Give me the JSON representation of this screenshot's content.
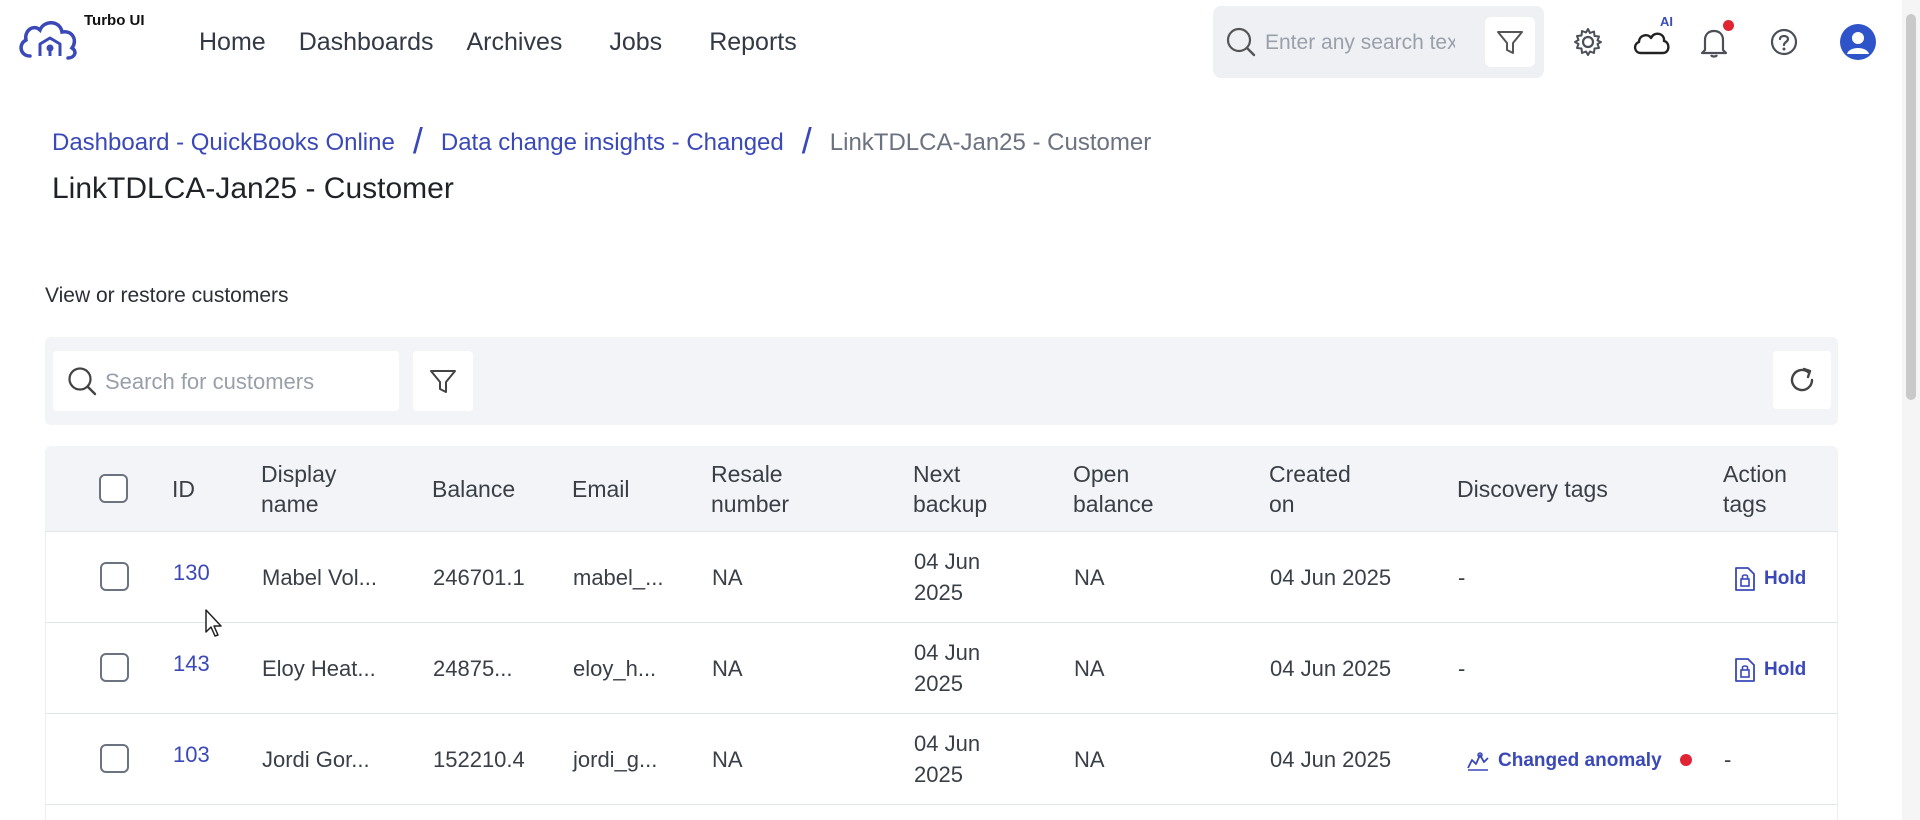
{
  "app": {
    "name": "Turbo UI"
  },
  "nav": {
    "items": [
      "Home",
      "Dashboards",
      "Archives",
      "Jobs",
      "Reports"
    ]
  },
  "global_search": {
    "placeholder": "Enter any search text"
  },
  "header_icons": {
    "ai_label": "AI",
    "icons": [
      "gear-icon",
      "ai-cloud-icon",
      "bell-icon",
      "help-icon",
      "user-avatar-icon"
    ]
  },
  "breadcrumb": {
    "items": [
      "Dashboard - QuickBooks Online",
      "Data change insights - Changed"
    ],
    "separator": "/",
    "current": "LinkTDLCA-Jan25 - Customer"
  },
  "page_title": "LinkTDLCA-Jan25 - Customer",
  "section_label": "View or restore customers",
  "toolbar": {
    "search_placeholder": "Search for customers"
  },
  "table": {
    "columns": {
      "id": "ID",
      "display_name": [
        "Display",
        "name"
      ],
      "balance": "Balance",
      "email": "Email",
      "resale_number": [
        "Resale",
        "number"
      ],
      "next_backup": [
        "Next",
        "backup"
      ],
      "open_balance": [
        "Open",
        "balance"
      ],
      "created_on": [
        "Created",
        "on"
      ],
      "discovery_tags": "Discovery tags",
      "action_tags": [
        "Action",
        "tags"
      ]
    },
    "rows": [
      {
        "id": "130",
        "display_name": "Mabel Vol...",
        "balance": "246701.1",
        "email": "mabel_...",
        "resale_number": "NA",
        "next_backup": [
          "04 Jun",
          "2025"
        ],
        "open_balance": "NA",
        "created_on": "04 Jun 2025",
        "discovery_tags": "-",
        "action_tags": "Hold"
      },
      {
        "id": "143",
        "display_name": "Eloy Heat...",
        "balance": "24875...",
        "email": "eloy_h...",
        "resale_number": "NA",
        "next_backup": [
          "04 Jun",
          "2025"
        ],
        "open_balance": "NA",
        "created_on": "04 Jun 2025",
        "discovery_tags": "-",
        "action_tags": "Hold"
      },
      {
        "id": "103",
        "display_name": "Jordi Gor...",
        "balance": "152210.4",
        "email": "jordi_g...",
        "resale_number": "NA",
        "next_backup": [
          "04 Jun",
          "2025"
        ],
        "open_balance": "NA",
        "created_on": "04 Jun 2025",
        "discovery_tags": "Changed anomaly",
        "action_tags": "-"
      }
    ]
  },
  "colors": {
    "accent": "#3a49b7",
    "alert": "#e02434",
    "panel": "#f2f4f7"
  }
}
